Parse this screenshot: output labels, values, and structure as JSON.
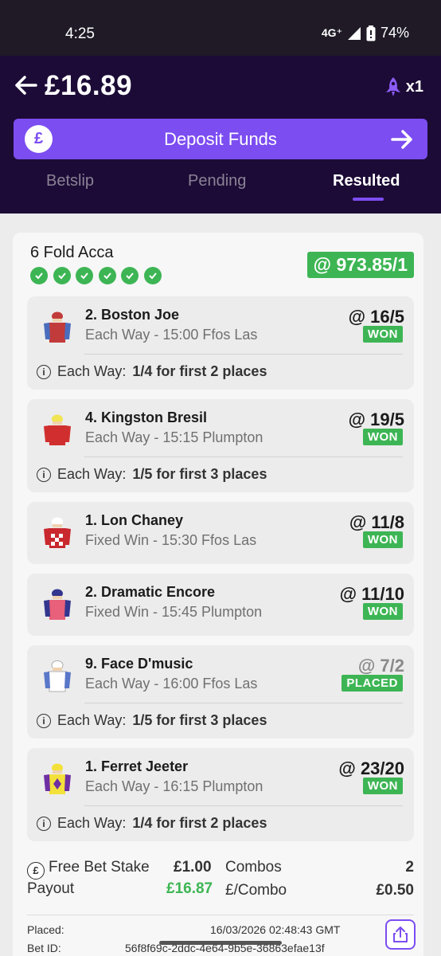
{
  "status_bar": {
    "time": "4:25",
    "network": "4G⁺",
    "battery": "74%"
  },
  "header": {
    "balance": "£16.89",
    "boost_count": "x1",
    "deposit_label": "Deposit Funds",
    "deposit_icon_glyph": "£"
  },
  "tabs": [
    {
      "label": "Betslip"
    },
    {
      "label": "Pending"
    },
    {
      "label": "Resulted"
    }
  ],
  "bet": {
    "title": "6 Fold Acca",
    "odds": "@ 973.85/1",
    "selections": [
      {
        "horse": "2. Boston Joe",
        "market": "Each Way - 15:00 Ffos Las",
        "odds": "@ 16/5",
        "result": "WON",
        "ew_label": "Each Way:",
        "ew_terms": "1/4 for first 2 places",
        "silk": {
          "body": "#c23b3b",
          "sleeves": "#4b6dbd",
          "cap": "#c23b3b"
        }
      },
      {
        "horse": "4. Kingston Bresil",
        "market": "Each Way - 15:15 Plumpton",
        "odds": "@ 19/5",
        "result": "WON",
        "ew_label": "Each Way:",
        "ew_terms": "1/5 for first 3 places",
        "silk": {
          "body": "#d12f2f",
          "sleeves": "#d12f2f",
          "cap": "#f1e455"
        }
      },
      {
        "horse": "1. Lon Chaney",
        "market": "Fixed Win - 15:30 Ffos Las",
        "odds": "@ 11/8",
        "result": "WON",
        "silk": {
          "body": "#c8282e",
          "sleeves": "#c8282e",
          "cap": "#ffffff"
        }
      },
      {
        "horse": "2. Dramatic Encore",
        "market": "Fixed Win - 15:45 Plumpton",
        "odds": "@ 11/10",
        "result": "WON",
        "silk": {
          "body": "#e8607a",
          "sleeves": "#33368f",
          "cap": "#33368f"
        }
      },
      {
        "horse": "9. Face D'music",
        "market": "Each Way - 16:00 Ffos Las",
        "odds": "@ 7/2",
        "result": "PLACED",
        "ew_label": "Each Way:",
        "ew_terms": "1/5 for first 3 places",
        "silk": {
          "body": "#ffffff",
          "sleeves": "#5a78c9",
          "cap": "#ffffff"
        }
      },
      {
        "horse": "1. Ferret Jeeter",
        "market": "Each Way - 16:15 Plumpton",
        "odds": "@ 23/20",
        "result": "WON",
        "ew_label": "Each Way:",
        "ew_terms": "1/4 for first 2 places",
        "silk": {
          "body": "#f3e13b",
          "sleeves": "#6e2fa3",
          "cap": "#f3e13b"
        }
      }
    ],
    "summary": {
      "stake_label": "Free Bet Stake",
      "stake_value": "£1.00",
      "payout_label": "Payout",
      "payout_value": "£16.87",
      "combos_label": "Combos",
      "combos_value": "2",
      "per_combo_label": "£/Combo",
      "per_combo_value": "£0.50",
      "placed_label": "Placed:",
      "placed_value": "16/03/2026 02:48:43 GMT",
      "betid_label": "Bet ID:",
      "betid_value": "56f8f69c-2ddc-4e64-9b5e-36863efae13f"
    }
  },
  "colors": {
    "header_bg": "#1c0b36",
    "accent": "#7c4df1",
    "won_green": "#3db554"
  }
}
